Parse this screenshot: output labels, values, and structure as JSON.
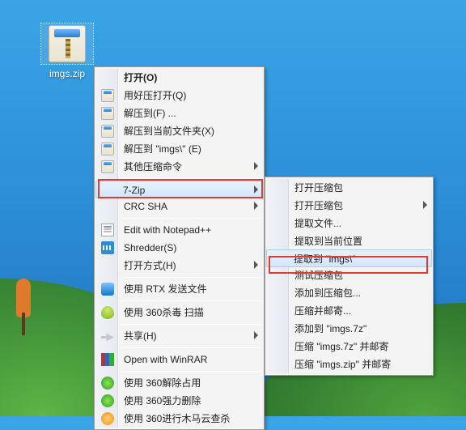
{
  "file": {
    "name": "imgs.zip"
  },
  "menu": {
    "open": "打开(O)",
    "haozip_open": "用好压打开(Q)",
    "extract_to": "解压到(F) ...",
    "extract_here": "解压到当前文件夹(X)",
    "extract_imgs": "解压到 \"imgs\\\" (E)",
    "other_cmds": "其他压缩命令",
    "seven_zip": "7-Zip",
    "crc_sha": "CRC SHA",
    "edit_npp": "Edit with Notepad++",
    "shredder": "Shredder(S)",
    "open_with": "打开方式(H)",
    "rtx_send": "使用 RTX 发送文件",
    "scan_360": "使用 360杀毒 扫描",
    "share": "共享(H)",
    "open_winrar": "Open with WinRAR",
    "unlock_360": "使用 360解除占用",
    "force_del_360": "使用 360强力删除",
    "trojan_360": "使用 360进行木马云查杀"
  },
  "submenu": {
    "open_archive": "打开压缩包",
    "open_archive2": "打开压缩包",
    "extract_files": "提取文件...",
    "extract_here": "提取到当前位置",
    "extract_imgs": "提取到 \"imgs\\\"",
    "test_archive": "测试压缩包",
    "add_to_archive": "添加到压缩包...",
    "compress_email": "压缩并邮寄...",
    "add_imgs7z": "添加到 \"imgs.7z\"",
    "comp_7z_mail": "压缩 \"imgs.7z\" 并邮寄",
    "comp_zip_mail": "压缩 \"imgs.zip\" 并邮寄"
  }
}
